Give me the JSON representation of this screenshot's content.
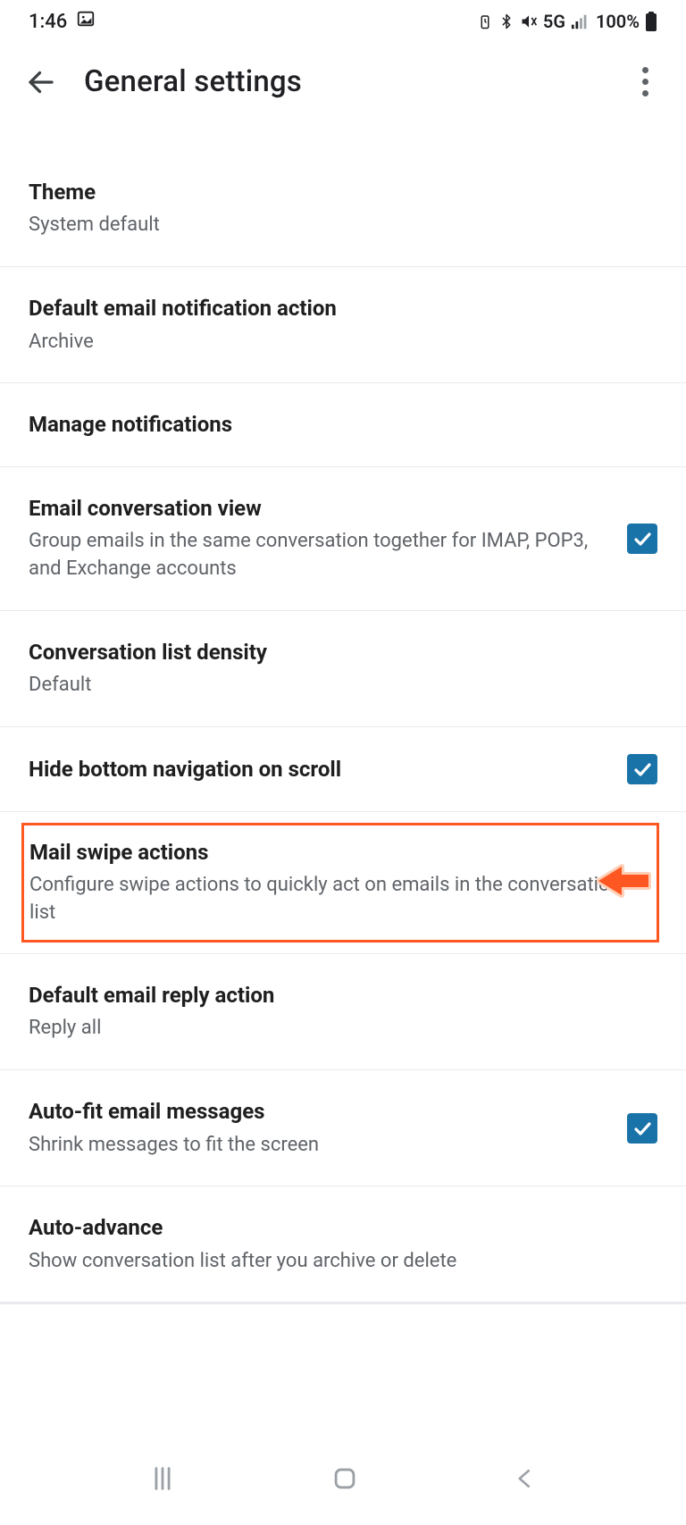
{
  "status": {
    "time": "1:46",
    "network": "5G",
    "battery": "100%"
  },
  "header": {
    "title": "General settings"
  },
  "settings": {
    "theme": {
      "title": "Theme",
      "subtitle": "System default"
    },
    "default_notify": {
      "title": "Default email notification action",
      "subtitle": "Archive"
    },
    "manage_notify": {
      "title": "Manage notifications"
    },
    "conv_view": {
      "title": "Email conversation view",
      "subtitle": "Group emails in the same conversation together for IMAP, POP3, and Exchange accounts"
    },
    "list_density": {
      "title": "Conversation list density",
      "subtitle": "Default"
    },
    "hide_nav": {
      "title": "Hide bottom navigation on scroll"
    },
    "swipe": {
      "title": "Mail swipe actions",
      "subtitle": "Configure swipe actions to quickly act on emails in the conversation list"
    },
    "default_reply": {
      "title": "Default email reply action",
      "subtitle": "Reply all"
    },
    "autofit": {
      "title": "Auto-fit email messages",
      "subtitle": "Shrink messages to fit the screen"
    },
    "autoadvance": {
      "title": "Auto-advance",
      "subtitle": "Show conversation list after you archive or delete"
    }
  }
}
